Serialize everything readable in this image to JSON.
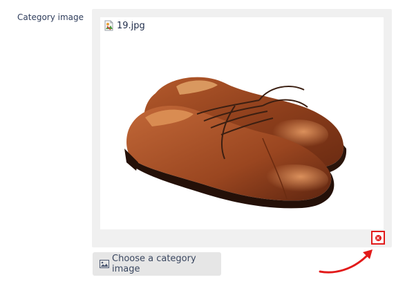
{
  "form": {
    "label": "Category image"
  },
  "image": {
    "file_name": "19.jpg",
    "icon": "broken-image-file-icon",
    "alt": "Brown leather oxford shoes"
  },
  "actions": {
    "remove_icon": "close-circle-icon",
    "choose_label": "Choose a category image",
    "choose_icon": "picture-icon"
  },
  "annotation": {
    "arrow_color": "#e21a1a"
  },
  "colors": {
    "panel_bg": "#f0f0f0",
    "button_bg": "#e6e6e6",
    "accent_red": "#e21a1a",
    "label_text": "#2f3d5c"
  }
}
